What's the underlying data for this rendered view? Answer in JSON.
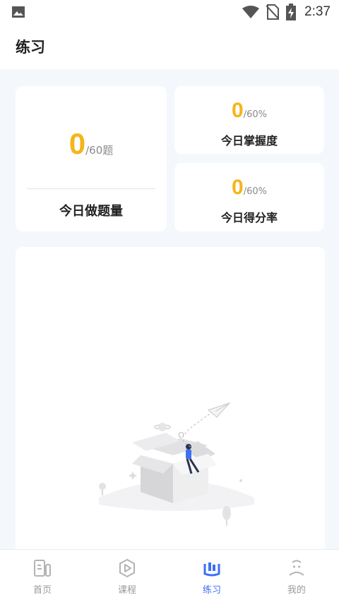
{
  "status_bar": {
    "time": "2:37",
    "icons": [
      "image-icon",
      "wifi-icon",
      "no-sim-icon",
      "battery-charging-icon"
    ]
  },
  "header": {
    "title": "练习"
  },
  "stats": {
    "daily_questions": {
      "value": "0",
      "total": "/60题",
      "label": "今日做题量"
    },
    "mastery": {
      "value": "0",
      "total": "/60%",
      "label": "今日掌握度"
    },
    "score_rate": {
      "value": "0",
      "total": "/60%",
      "label": "今日得分率"
    }
  },
  "empty_state": {
    "illustration": "empty-box-paper-plane-illustration"
  },
  "bottom_nav": {
    "items": [
      {
        "label": "首页",
        "icon": "home-icon",
        "active": false
      },
      {
        "label": "课程",
        "icon": "play-circle-icon",
        "active": false
      },
      {
        "label": "练习",
        "icon": "practice-icon",
        "active": true
      },
      {
        "label": "我的",
        "icon": "profile-icon",
        "active": false
      }
    ]
  },
  "colors": {
    "accent": "#3e6ff5",
    "stat_value": "#f5b51a",
    "background": "#f4f7fc",
    "card": "#ffffff"
  }
}
